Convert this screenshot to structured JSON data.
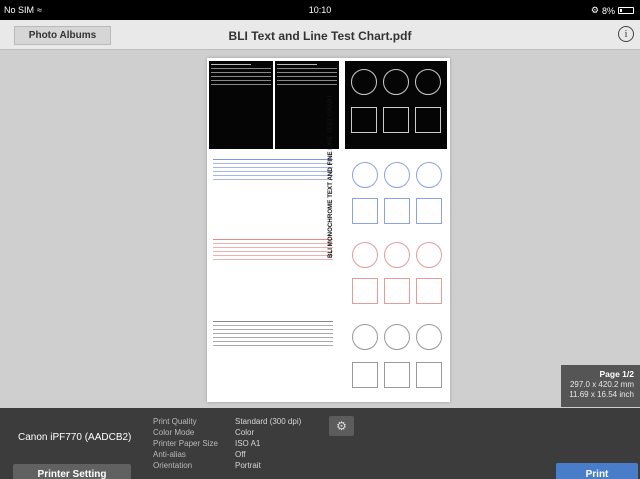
{
  "status_bar": {
    "carrier": "No SIM",
    "time": "10:10",
    "battery": "8%"
  },
  "navbar": {
    "albums_button": "Photo Albums",
    "title": "BLI Text and Line Test Chart.pdf",
    "info_icon": "info-icon"
  },
  "page_info": {
    "page": "Page 1/2",
    "size_mm": "297.0 x 420.2 mm",
    "size_inch": "11.69 x 16.54 inch"
  },
  "printer": {
    "name": "Canon iPF770 (AADCB2)",
    "setting_button": "Printer Setting",
    "print_button": "Print"
  },
  "print_settings": [
    {
      "label": "Print Quality",
      "value": "Standard (300 dpi)"
    },
    {
      "label": "Color Mode",
      "value": "Color"
    },
    {
      "label": "Printer Paper Size",
      "value": "ISO A1"
    },
    {
      "label": "Anti-alias",
      "value": "Off"
    },
    {
      "label": "Orientation",
      "value": "Portrait"
    }
  ],
  "preview_doc": {
    "heading": "BLI MONOCHROME TEXT AND FINE LINE TEST CHART"
  },
  "colors": {
    "accent": "#4a7dc9",
    "blue_text": "#2a4fd0",
    "red_text": "#d02a2a"
  }
}
